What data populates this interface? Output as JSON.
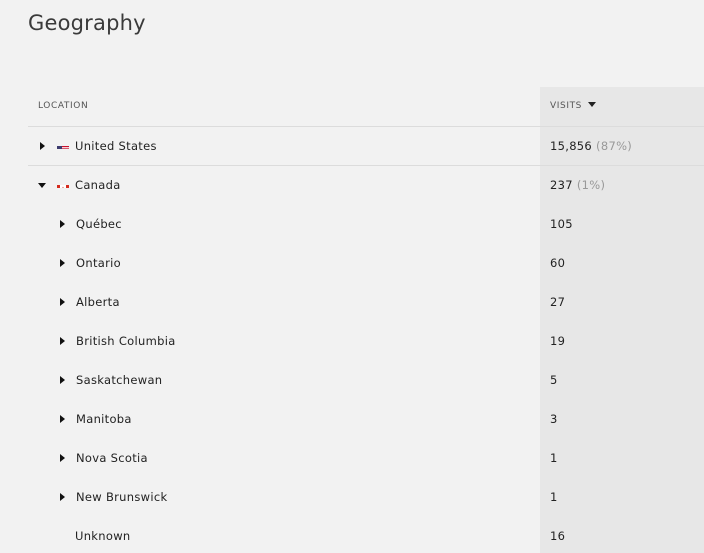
{
  "title": "Geography",
  "table": {
    "location_header": "LOCATION",
    "visits_header": "VISITS",
    "rows": [
      {
        "name": "United States",
        "visits": "15,856",
        "pct": "(87%)",
        "flag": "us-flag-icon",
        "state": "collapsed"
      },
      {
        "name": "Canada",
        "visits": "237",
        "pct": "(1%)",
        "flag": "canada-flag-icon",
        "state": "expanded"
      },
      {
        "name": "Québec",
        "visits": "105"
      },
      {
        "name": "Ontario",
        "visits": "60"
      },
      {
        "name": "Alberta",
        "visits": "27"
      },
      {
        "name": "British Columbia",
        "visits": "19"
      },
      {
        "name": "Saskatchewan",
        "visits": "5"
      },
      {
        "name": "Manitoba",
        "visits": "3"
      },
      {
        "name": "Nova Scotia",
        "visits": "1"
      },
      {
        "name": "New Brunswick",
        "visits": "1"
      },
      {
        "name": "Unknown",
        "visits": "16"
      }
    ]
  },
  "colors": {
    "background": "#f2f2f2",
    "visits_column": "#e7e7e7",
    "percent_text": "#999999"
  }
}
